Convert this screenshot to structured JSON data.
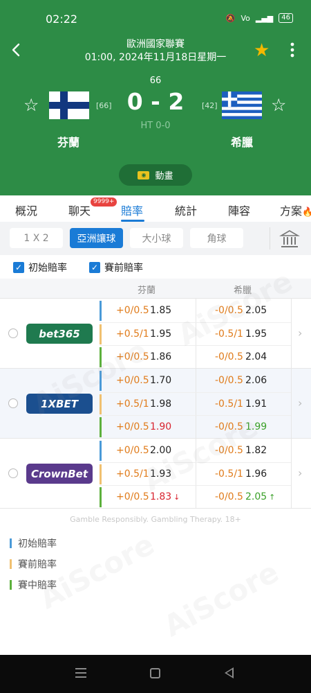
{
  "status_bar": {
    "time": "02:22",
    "icons": [
      "mute-icon",
      "volte-icon",
      "4g-signal-icon",
      "battery-icon"
    ],
    "battery": "46"
  },
  "match": {
    "league": "歐洲國家聯賽",
    "kickoff": "01:00, 2024年11月18日星期一",
    "minute": "66",
    "score": "0 - 2",
    "halftime": "HT 0-0",
    "home": {
      "name": "芬蘭",
      "rank": "[66]",
      "flag": "finland-flag"
    },
    "away": {
      "name": "希臘",
      "rank": "[42]",
      "flag": "greece-flag"
    },
    "animation_label": "動畫",
    "favorite_color": "#f5b800"
  },
  "tabs": [
    {
      "label": "概況"
    },
    {
      "label": "聊天",
      "badge": "9999+"
    },
    {
      "label": "賠率",
      "active": true
    },
    {
      "label": "統計"
    },
    {
      "label": "陣容"
    },
    {
      "label": "方案"
    }
  ],
  "odds_tabs": [
    {
      "label": "1 X 2"
    },
    {
      "label": "亞洲讓球",
      "active": true
    },
    {
      "label": "大小球"
    },
    {
      "label": "角球"
    }
  ],
  "checkboxes": {
    "opening": "初始賠率",
    "prematch": "賽前賠率"
  },
  "table_header": {
    "home": "芬蘭",
    "away": "希臘"
  },
  "bookmakers": [
    {
      "name": "bet365",
      "color": "#1f7a4f",
      "lines": [
        {
          "type": "opening",
          "home_hcp": "+0/0.5",
          "home_odds": "1.85",
          "away_hcp": "-0/0.5",
          "away_odds": "2.05"
        },
        {
          "type": "prematch",
          "home_hcp": "+0.5/1",
          "home_odds": "1.95",
          "away_hcp": "-0.5/1",
          "away_odds": "1.95"
        },
        {
          "type": "live",
          "home_hcp": "+0/0.5",
          "home_odds": "1.86",
          "away_hcp": "-0/0.5",
          "away_odds": "2.04"
        }
      ]
    },
    {
      "name": "1XBET",
      "color": "#1b4f8f",
      "lines": [
        {
          "type": "opening",
          "home_hcp": "+0/0.5",
          "home_odds": "1.70",
          "away_hcp": "-0/0.5",
          "away_odds": "2.06"
        },
        {
          "type": "prematch",
          "home_hcp": "+0.5/1",
          "home_odds": "1.98",
          "away_hcp": "-0.5/1",
          "away_odds": "1.91"
        },
        {
          "type": "live",
          "home_hcp": "+0/0.5",
          "home_odds": "1.90",
          "home_trend": "down",
          "away_hcp": "-0/0.5",
          "away_odds": "1.99",
          "away_trend": "up"
        }
      ]
    },
    {
      "name": "CrownBet",
      "color": "#5a3a8c",
      "lines": [
        {
          "type": "opening",
          "home_hcp": "+0/0.5",
          "home_odds": "2.00",
          "away_hcp": "-0/0.5",
          "away_odds": "1.82"
        },
        {
          "type": "prematch",
          "home_hcp": "+0.5/1",
          "home_odds": "1.93",
          "away_hcp": "-0.5/1",
          "away_odds": "1.96"
        },
        {
          "type": "live",
          "home_hcp": "+0/0.5",
          "home_odds": "1.83",
          "home_trend": "down",
          "home_arrow": "↓",
          "away_hcp": "-0/0.5",
          "away_odds": "2.05",
          "away_trend": "up",
          "away_arrow": "↑"
        }
      ]
    }
  ],
  "disclaimer": "Gamble Responsibly. Gambling Therapy. 18+",
  "legend": [
    {
      "label": "初始賠率",
      "color": "#4a9ad8"
    },
    {
      "label": "賽前賠率",
      "color": "#f0c070"
    },
    {
      "label": "賽中賠率",
      "color": "#5cb03c"
    }
  ],
  "watermark": "AiScore",
  "colors": {
    "header": "#2d8c46",
    "accent": "#1a7bd6",
    "handicap": "#e07b1a",
    "up": "#3aa028",
    "down": "#d8232f"
  }
}
